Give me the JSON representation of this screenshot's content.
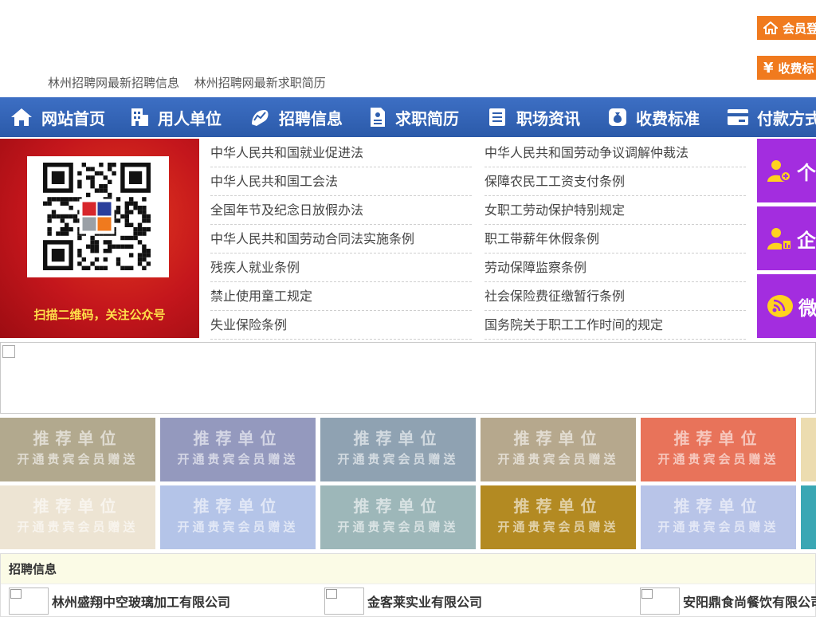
{
  "header": {
    "links": [
      "林州招聘网最新招聘信息",
      "林州招聘网最新求职简历"
    ],
    "login_btn": "会员登",
    "fee_btn": "收费标",
    "fee_symbol": "¥"
  },
  "nav": {
    "items": [
      {
        "label": "网站首页",
        "icon": "home-icon"
      },
      {
        "label": "用人单位",
        "icon": "building-icon"
      },
      {
        "label": "招聘信息",
        "icon": "chart-icon"
      },
      {
        "label": "求职简历",
        "icon": "document-icon"
      },
      {
        "label": "职场资讯",
        "icon": "news-icon"
      },
      {
        "label": "收费标准",
        "icon": "money-bag-icon"
      },
      {
        "label": "付款方式",
        "icon": "card-icon"
      }
    ]
  },
  "promo": {
    "caption": "扫描二维码，关注公众号"
  },
  "laws": [
    [
      "中华人民共和国就业促进法",
      "中华人民共和国劳动争议调解仲裁法"
    ],
    [
      "中华人民共和国工会法",
      "保障农民工工资支付条例"
    ],
    [
      "全国年节及纪念日放假办法",
      "女职工劳动保护特别规定"
    ],
    [
      "中华人民共和国劳动合同法实施条例",
      "职工带薪年休假条例"
    ],
    [
      "残疾人就业条例",
      "劳动保障监察条例"
    ],
    [
      "禁止使用童工规定",
      "社会保险费征缴暂行条例"
    ],
    [
      "失业保险条例",
      "国务院关于职工工作时间的规定"
    ]
  ],
  "side_buttons": [
    {
      "label": "个",
      "icon": "person-add-icon"
    },
    {
      "label": "企",
      "icon": "company-user-icon"
    },
    {
      "label": "微",
      "icon": "wifi-chat-icon"
    }
  ],
  "tiles": {
    "line1": "推荐单位",
    "line2": "开通贵宾会员赠送",
    "row1_colors": [
      "#b2a98e",
      "#9499be",
      "#8fa2b2",
      "#b6a88d",
      "#e8735a",
      "#ecdcb0"
    ],
    "row2_colors": [
      "#ede4d3",
      "#b4c4e8",
      "#9db7b9",
      "#b38a22",
      "#b8c4e8",
      "#3aa7b4"
    ]
  },
  "jobs": {
    "title": "招聘信息",
    "companies": [
      "林州盛翔中空玻璃加工有限公司",
      "金客莱实业有限公司",
      "安阳鼎食尚餐饮有限公司"
    ]
  },
  "colors": {
    "nav_bg": "#2f5fae",
    "orange": "#f07a1e",
    "purple": "#a32ddf",
    "promo_red": "#c4161c",
    "promo_caption": "#ffe04a"
  }
}
